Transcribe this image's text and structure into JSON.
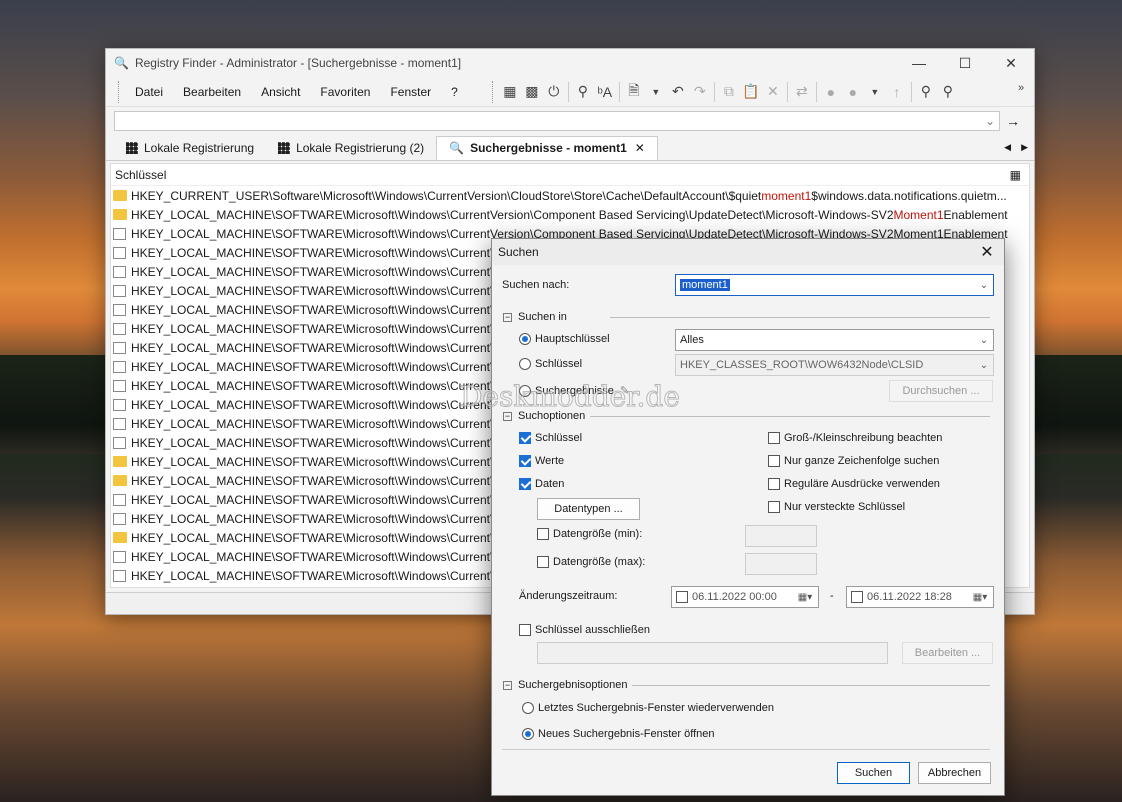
{
  "window": {
    "title": "Registry Finder - Administrator - [Suchergebnisse - moment1]",
    "minimize": "—",
    "maximize": "☐",
    "close": "✕"
  },
  "menu": [
    "Datei",
    "Bearbeiten",
    "Ansicht",
    "Favoriten",
    "Fenster",
    "?"
  ],
  "toolbar": {
    "more": "»",
    "go": "→"
  },
  "tabs": [
    {
      "label": "Lokale Registrierung"
    },
    {
      "label": "Lokale Registrierung (2)"
    },
    {
      "label": "Suchergebnisse - moment1",
      "close": "✕"
    }
  ],
  "tabnav": {
    "prev": "◀",
    "next": "▶"
  },
  "results": {
    "column": "Schlüssel",
    "rows": [
      {
        "pre": "HKEY_CURRENT_USER\\Software\\Microsoft\\Windows\\CurrentVersion\\CloudStore\\Store\\Cache\\DefaultAccount\\$quiet",
        "hit": "moment1",
        "post": "$windows.data.notifications.quietm...",
        "icon": "folder"
      },
      {
        "pre": "HKEY_LOCAL_MACHINE\\SOFTWARE\\Microsoft\\Windows\\CurrentVersion\\Component Based Servicing\\UpdateDetect\\Microsoft-Windows-SV2",
        "hit": "Moment1",
        "post": "Enablement",
        "icon": "folder"
      },
      {
        "pre": "HKEY_LOCAL_MACHINE\\SOFTWARE\\Microsoft\\Windows\\CurrentVersion\\Component Based Servicing\\UpdateDetect\\Microsoft-Windows-SV2Moment1Enablement",
        "hit": "",
        "post": "",
        "icon": "key"
      },
      {
        "pre": "HKEY_LOCAL_MACHINE\\SOFTWARE\\Microsoft\\Windows\\CurrentVe",
        "hit": "",
        "post": "",
        "icon": "key"
      },
      {
        "pre": "HKEY_LOCAL_MACHINE\\SOFTWARE\\Microsoft\\Windows\\CurrentVe",
        "hit": "",
        "post": "",
        "icon": "key"
      },
      {
        "pre": "HKEY_LOCAL_MACHINE\\SOFTWARE\\Microsoft\\Windows\\CurrentVe",
        "hit": "",
        "post": "",
        "icon": "key"
      },
      {
        "pre": "HKEY_LOCAL_MACHINE\\SOFTWARE\\Microsoft\\Windows\\CurrentVe",
        "hit": "",
        "post": "",
        "icon": "key"
      },
      {
        "pre": "HKEY_LOCAL_MACHINE\\SOFTWARE\\Microsoft\\Windows\\CurrentVe",
        "hit": "",
        "post": "",
        "icon": "key"
      },
      {
        "pre": "HKEY_LOCAL_MACHINE\\SOFTWARE\\Microsoft\\Windows\\CurrentVe",
        "hit": "",
        "post": "",
        "icon": "key"
      },
      {
        "pre": "HKEY_LOCAL_MACHINE\\SOFTWARE\\Microsoft\\Windows\\CurrentVe",
        "hit": "",
        "post": "",
        "icon": "key"
      },
      {
        "pre": "HKEY_LOCAL_MACHINE\\SOFTWARE\\Microsoft\\Windows\\CurrentVe",
        "hit": "",
        "post": "",
        "icon": "key"
      },
      {
        "pre": "HKEY_LOCAL_MACHINE\\SOFTWARE\\Microsoft\\Windows\\CurrentVe",
        "hit": "",
        "post": "",
        "icon": "key"
      },
      {
        "pre": "HKEY_LOCAL_MACHINE\\SOFTWARE\\Microsoft\\Windows\\CurrentVe",
        "hit": "",
        "post": "",
        "icon": "key"
      },
      {
        "pre": "HKEY_LOCAL_MACHINE\\SOFTWARE\\Microsoft\\Windows\\CurrentVe",
        "hit": "",
        "post": "",
        "icon": "key"
      },
      {
        "pre": "HKEY_LOCAL_MACHINE\\SOFTWARE\\Microsoft\\Windows\\CurrentVe",
        "hit": "",
        "post": "",
        "icon": "folder"
      },
      {
        "pre": "HKEY_LOCAL_MACHINE\\SOFTWARE\\Microsoft\\Windows\\CurrentVe",
        "hit": "",
        "post": "",
        "icon": "folder"
      },
      {
        "pre": "HKEY_LOCAL_MACHINE\\SOFTWARE\\Microsoft\\Windows\\CurrentVe",
        "hit": "",
        "post": "",
        "icon": "key"
      },
      {
        "pre": "HKEY_LOCAL_MACHINE\\SOFTWARE\\Microsoft\\Windows\\CurrentVe",
        "hit": "",
        "post": "",
        "icon": "key"
      },
      {
        "pre": "HKEY_LOCAL_MACHINE\\SOFTWARE\\Microsoft\\Windows\\CurrentVe",
        "hit": "",
        "post": "",
        "icon": "folder"
      },
      {
        "pre": "HKEY_LOCAL_MACHINE\\SOFTWARE\\Microsoft\\Windows\\CurrentVe",
        "hit": "",
        "post": "",
        "icon": "key"
      },
      {
        "pre": "HKEY_LOCAL_MACHINE\\SOFTWARE\\Microsoft\\Windows\\CurrentVe",
        "hit": "",
        "post": "",
        "icon": "key"
      }
    ]
  },
  "dialog": {
    "title": "Suchen",
    "close": "✕",
    "search_label": "Suchen nach:",
    "search_value": "moment1",
    "group_searchin": "Suchen in",
    "rb_hauptschluessel": "Hauptschlüssel",
    "hauptschluessel_value": "Alles",
    "rb_schluessel": "Schlüssel",
    "schluessel_value": "HKEY_CLASSES_ROOT\\WOW6432Node\\CLSID",
    "rb_suchergebnisse": "Suchergebnisse",
    "btn_durchsuchen": "Durchsuchen ...",
    "group_options": "Suchoptionen",
    "cb_schluessel": "Schlüssel",
    "cb_werte": "Werte",
    "cb_daten": "Daten",
    "btn_datentypen": "Datentypen ...",
    "cb_gross": "Groß-/Kleinschreibung beachten",
    "cb_ganze": "Nur ganze Zeichenfolge suchen",
    "cb_regex": "Reguläre Ausdrücke verwenden",
    "cb_versteckt": "Nur versteckte Schlüssel",
    "cb_min": "Datengröße (min):",
    "cb_max": "Datengröße (max):",
    "label_zeitraum": "Änderungszeitraum:",
    "date_from": "06.11.2022 00:00",
    "date_sep": "-",
    "date_to": "06.11.2022 18:28",
    "cb_ausschliessen": "Schlüssel ausschließen",
    "btn_bearbeiten": "Bearbeiten ...",
    "group_results": "Suchergebnisoptionen",
    "rb_letztes": "Letztes Suchergebnis-Fenster wiederverwenden",
    "rb_neues": "Neues Suchergebnis-Fenster öffnen",
    "btn_suchen": "Suchen",
    "btn_abbrechen": "Abbrechen"
  },
  "watermark": "Deskmodder.de"
}
